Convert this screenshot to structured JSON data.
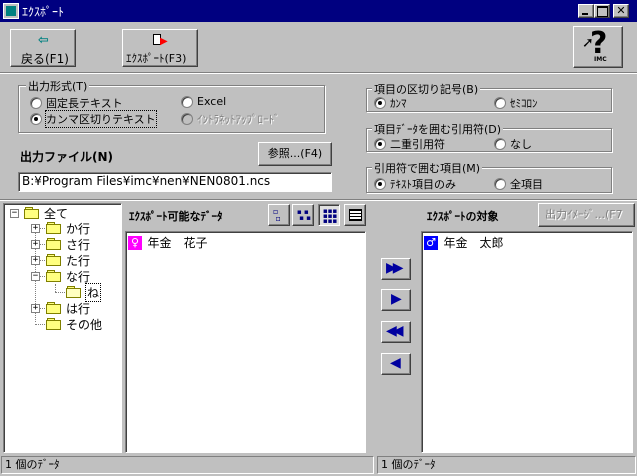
{
  "window": {
    "title": "ｴｸｽﾎﾟｰﾄ",
    "controls": [
      "minimize",
      "maximize",
      "close"
    ]
  },
  "toolbar": {
    "back_label": "戻る(F1)",
    "export_label": "ｴｸｽﾎﾟｰﾄ(F3)",
    "help_badge": "IMC"
  },
  "output_format": {
    "legend": "出力形式(T)",
    "options": [
      {
        "label": "固定長テキスト",
        "selected": false,
        "enabled": true
      },
      {
        "label": "Excel",
        "selected": false,
        "enabled": true
      },
      {
        "label": "カンマ区切りテキスト",
        "selected": true,
        "enabled": true
      },
      {
        "label": "ｲﾝﾄﾗﾈｯﾄｱｯﾌﾟﾛｰﾄﾞ",
        "selected": false,
        "enabled": false
      }
    ]
  },
  "output_file": {
    "label": "出力ファイル(N)",
    "browse_label": "参照...(F4)",
    "path": "B:¥Program Files¥imc¥nen¥NEN0801.ncs"
  },
  "delimiter": {
    "legend": "項目の区切り記号(B)",
    "options": [
      {
        "label": "ｶﾝﾏ",
        "selected": true
      },
      {
        "label": "ｾﾐｺﾛﾝ",
        "selected": false
      }
    ]
  },
  "quote": {
    "legend": "項目ﾃﾞｰﾀを囲む引用符(D)",
    "options": [
      {
        "label": "二重引用符",
        "selected": true
      },
      {
        "label": "なし",
        "selected": false
      }
    ]
  },
  "quoted_items": {
    "legend": "引用符で囲む項目(M)",
    "options": [
      {
        "label": "ﾃｷｽﾄ項目のみ",
        "selected": true
      },
      {
        "label": "全項目",
        "selected": false
      }
    ]
  },
  "tree": {
    "root": "全て",
    "items": [
      {
        "label": "か行",
        "expandable": true,
        "open": false
      },
      {
        "label": "さ行",
        "expandable": true,
        "open": false
      },
      {
        "label": "た行",
        "expandable": true,
        "open": false
      },
      {
        "label": "な行",
        "expandable": true,
        "open": true
      },
      {
        "label": "ね",
        "expandable": false,
        "open": true,
        "child": true,
        "selected": true
      },
      {
        "label": "は行",
        "expandable": true,
        "open": false
      },
      {
        "label": "その他",
        "expandable": false,
        "open": false
      }
    ]
  },
  "available": {
    "header": "ｴｸｽﾎﾟｰﾄ可能なﾃﾞｰﾀ",
    "items": [
      "年金　花子"
    ],
    "status": "1 個のﾃﾞｰﾀ"
  },
  "target": {
    "header": "ｴｸｽﾎﾟｰﾄの対象",
    "preview_label": "出力ｲﾒｰｼﾞ...(F7",
    "items": [
      "年金　太郎"
    ],
    "status": "1 個のﾃﾞｰﾀ"
  },
  "colors": {
    "titlebar": "#000080",
    "face": "#c0c0c0",
    "arrow": "#0000a0",
    "female_icon": "#ff00ff",
    "male_icon": "#0000ff"
  }
}
